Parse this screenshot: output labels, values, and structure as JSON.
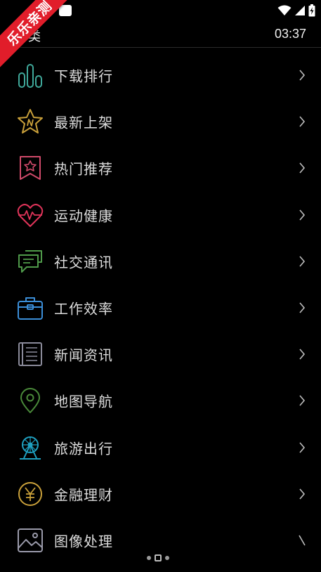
{
  "app": {
    "title_fragment": "类",
    "time": "03:37"
  },
  "badge": {
    "text": "乐乐亲测",
    "color": "#e11d2a"
  },
  "categories": [
    {
      "label": "下载排行",
      "icon": "bar-chart-icon",
      "color": "#3fa89a"
    },
    {
      "label": "最新上架",
      "icon": "star-n-icon",
      "color": "#c9a03a"
    },
    {
      "label": "热门推荐",
      "icon": "bookmark-star-icon",
      "color": "#d04a6a"
    },
    {
      "label": "运动健康",
      "icon": "heartbeat-icon",
      "color": "#e0345a"
    },
    {
      "label": "社交通讯",
      "icon": "chat-bubbles-icon",
      "color": "#4f9a4a"
    },
    {
      "label": "工作效率",
      "icon": "briefcase-icon",
      "color": "#3b8ed8"
    },
    {
      "label": "新闻资讯",
      "icon": "newspaper-icon",
      "color": "#8a8a9a"
    },
    {
      "label": "地图导航",
      "icon": "map-pin-icon",
      "color": "#4a8a3a"
    },
    {
      "label": "旅游出行",
      "icon": "ferris-wheel-icon",
      "color": "#1fa0c0"
    },
    {
      "label": "金融理财",
      "icon": "yen-coin-icon",
      "color": "#c9a03a"
    },
    {
      "label": "图像处理",
      "icon": "image-icon",
      "color": "#9a9aaa"
    }
  ]
}
